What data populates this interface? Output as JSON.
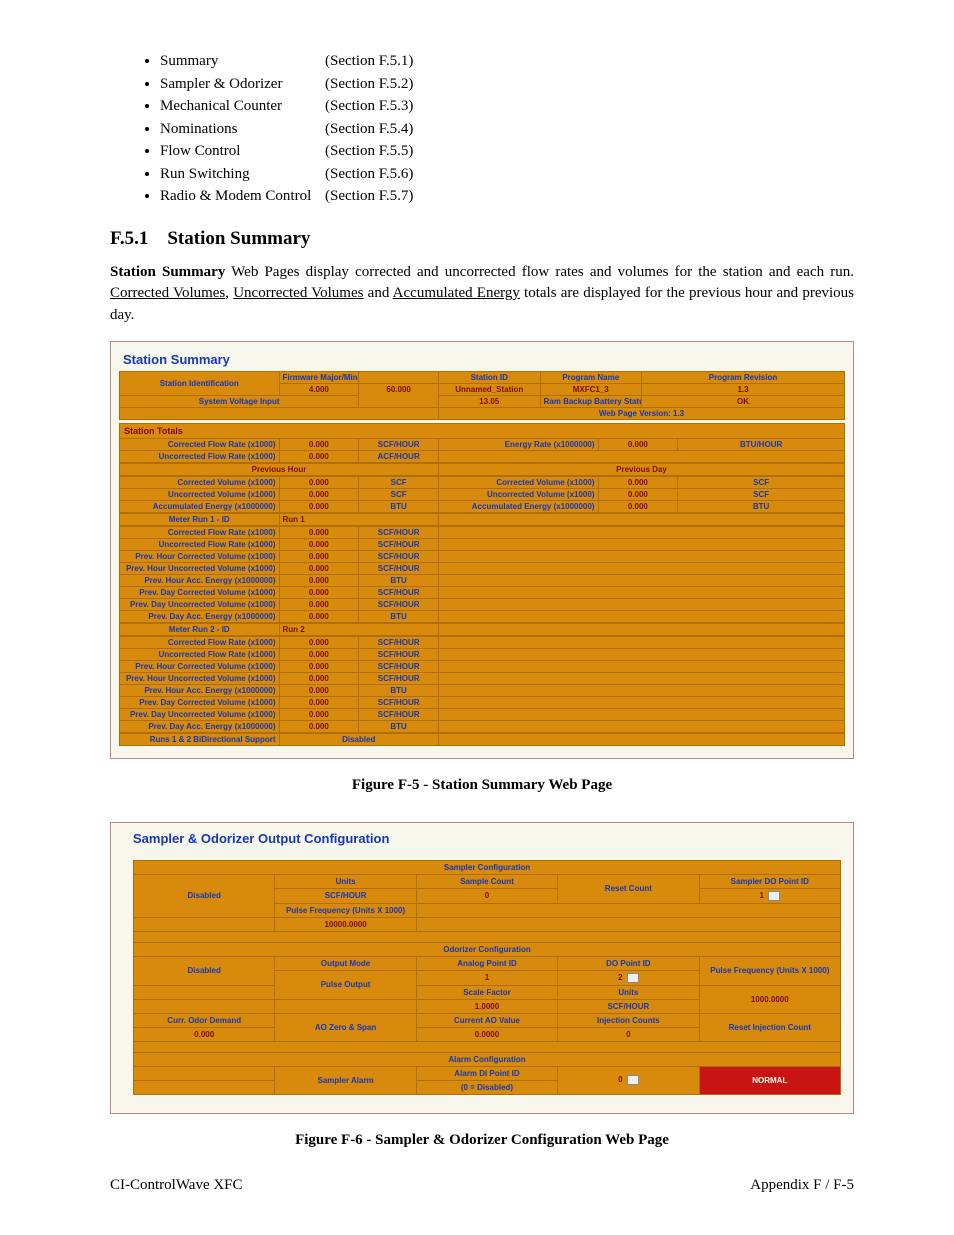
{
  "toc": [
    {
      "name": "Summary",
      "sec": "(Section F.5.1)"
    },
    {
      "name": "Sampler & Odorizer",
      "sec": "(Section F.5.2)"
    },
    {
      "name": "Mechanical Counter",
      "sec": "(Section F.5.3)"
    },
    {
      "name": "Nominations",
      "sec": "(Section F.5.4)"
    },
    {
      "name": "Flow Control",
      "sec": "(Section F.5.5)"
    },
    {
      "name": "Run Switching",
      "sec": "(Section F.5.6)"
    },
    {
      "name": "Radio & Modem Control",
      "sec": "(Section F.5.7)"
    }
  ],
  "heading": "F.5.1 Station Summary",
  "paragraph": {
    "lead": "Station Summary",
    "rest1": " Web Pages display corrected and uncorrected flow rates and volumes for the station and each run. ",
    "u1": "Corrected Volumes",
    "c1": ", ",
    "u2": "Uncorrected Volumes",
    "c2": " and ",
    "u3": "Accumulated Energy",
    "rest2": " totals are displayed for the previous hour and previous day."
  },
  "fig1": {
    "title": "Station Summary",
    "ident": {
      "row": "Station Identification",
      "fw_label": "Firmware Major/Minor",
      "fw_major": "4.000",
      "fw_minor": "60.000",
      "sid_label": "Station ID",
      "sid": "Unnamed_Station",
      "pname_label": "Program Name",
      "pname": "MXFC1_3",
      "prev_label": "Program Revision",
      "prev": "1.3",
      "svi_label": "System Voltage Input",
      "svi": "13.05",
      "rbbs_label": "Ram Backup Battery Status",
      "rbbs": "OK",
      "wpv": "Web Page Version: 1.3"
    },
    "totals_header": "Station Totals",
    "rates": {
      "cfr_l": "Corrected Flow Rate (x1000)",
      "cfr_v": "0.000",
      "cfr_u": "SCF/HOUR",
      "ufr_l": "Uncorrected Flow Rate (x1000)",
      "ufr_v": "0.000",
      "ufr_u": "ACF/HOUR",
      "er_l": "Energy Rate (x1000000)",
      "er_v": "0.000",
      "er_u": "BTU/HOUR"
    },
    "ph_header": "Previous Hour",
    "pd_header": "Previous Day",
    "ph": {
      "cv_l": "Corrected Volume (x1000)",
      "cv_v": "0.000",
      "cv_u": "SCF",
      "uv_l": "Uncorrected Volume (x1000)",
      "uv_v": "0.000",
      "uv_u": "SCF",
      "ae_l": "Accumulated Energy (x1000000)",
      "ae_v": "0.000",
      "ae_u": "BTU"
    },
    "pd": {
      "cv_l": "Corrected Volume (x1000)",
      "cv_v": "0.000",
      "cv_u": "SCF",
      "uv_l": "Uncorrected Volume (x1000)",
      "uv_v": "0.000",
      "uv_u": "SCF",
      "ae_l": "Accumulated Energy (x1000000)",
      "ae_v": "0.000",
      "ae_u": "BTU"
    },
    "run1": {
      "header": "Meter Run 1 - ID",
      "id": "Run 1",
      "rows": [
        {
          "l": "Corrected Flow Rate (x1000)",
          "v": "0.000",
          "u": "SCF/HOUR"
        },
        {
          "l": "Uncorrected Flow Rate (x1000)",
          "v": "0.000",
          "u": "SCF/HOUR"
        },
        {
          "l": "Prev. Hour Corrected Volume (x1000)",
          "v": "0.000",
          "u": "SCF/HOUR"
        },
        {
          "l": "Prev. Hour Uncorrected Volume (x1000)",
          "v": "0.000",
          "u": "SCF/HOUR"
        },
        {
          "l": "Prev. Hour Acc. Energy (x1000000)",
          "v": "0.000",
          "u": "BTU"
        },
        {
          "l": "Prev. Day Corrected Volume (x1000)",
          "v": "0.000",
          "u": "SCF/HOUR"
        },
        {
          "l": "Prev. Day Uncorrected Volume (x1000)",
          "v": "0.000",
          "u": "SCF/HOUR"
        },
        {
          "l": "Prev. Day Acc. Energy (x1000000)",
          "v": "0.000",
          "u": "BTU"
        }
      ]
    },
    "run2": {
      "header": "Meter Run 2 - ID",
      "id": "Run 2",
      "rows": [
        {
          "l": "Corrected Flow Rate (x1000)",
          "v": "0.000",
          "u": "SCF/HOUR"
        },
        {
          "l": "Uncorrected Flow Rate (x1000)",
          "v": "0.000",
          "u": "SCF/HOUR"
        },
        {
          "l": "Prev. Hour Corrected Volume (x1000)",
          "v": "0.000",
          "u": "SCF/HOUR"
        },
        {
          "l": "Prev. Hour Uncorrected Volume (x1000)",
          "v": "0.000",
          "u": "SCF/HOUR"
        },
        {
          "l": "Prev. Hour Acc. Energy (x1000000)",
          "v": "0.000",
          "u": "BTU"
        },
        {
          "l": "Prev. Day Corrected Volume (x1000)",
          "v": "0.000",
          "u": "SCF/HOUR"
        },
        {
          "l": "Prev. Day Uncorrected Volume (x1000)",
          "v": "0.000",
          "u": "SCF/HOUR"
        },
        {
          "l": "Prev. Day Acc. Energy (x1000000)",
          "v": "0.000",
          "u": "BTU"
        }
      ],
      "bidi_l": "Runs 1 & 2 BiDirectional Support",
      "bidi_v": "Disabled"
    },
    "caption": "Figure F-5 - Station Summary Web Page"
  },
  "fig2": {
    "title": "Sampler & Odorizer Output Configuration",
    "sampler_hdr": "Sampler Configuration",
    "sampler": {
      "disabled": "Disabled",
      "units_l": "Units",
      "units_v": "SCF/HOUR",
      "pf_l": "Pulse Frequency (Units X 1000)",
      "pf_v": "10000.0000",
      "sc_l": "Sample Count",
      "sc_v": "0",
      "rc_l": "Reset Count",
      "sdp_l": "Sampler DO Point ID",
      "sdp_v": "1"
    },
    "odor_hdr": "Odorizer Configuration",
    "odor": {
      "disabled": "Disabled",
      "om_l": "Output Mode",
      "om_v": "Pulse Output",
      "ap_l": "Analog Point ID",
      "ap_v": "1",
      "sf_l": "Scale Factor",
      "sf_v": "1.0000",
      "dop_l": "DO Point ID",
      "dop_v": "2",
      "units_l": "Units",
      "units_v": "SCF/HOUR",
      "pf_l": "Pulse Frequency (Units X 1000)",
      "pf_v": "1000.0000",
      "cod_l": "Curr. Odor Demand",
      "cod_v": "0.000",
      "aozs_l": "AO Zero & Span",
      "cao_l": "Current AO Value",
      "cao_v": "0.0000",
      "ic_l": "Injection Counts",
      "ic_v": "0",
      "ric_l": "Reset Injection Count"
    },
    "alarm_hdr": "Alarm Configuration",
    "alarm": {
      "sa_l": "Sampler Alarm",
      "adp_l": "Alarm DI Point ID",
      "adp_note": "(0 = Disabled)",
      "adp_v": "0",
      "status": "NORMAL"
    },
    "caption": "Figure F-6 - Sampler & Odorizer Configuration Web Page"
  },
  "footer": {
    "left": "CI-ControlWave XFC",
    "right": "Appendix F / F-5"
  }
}
